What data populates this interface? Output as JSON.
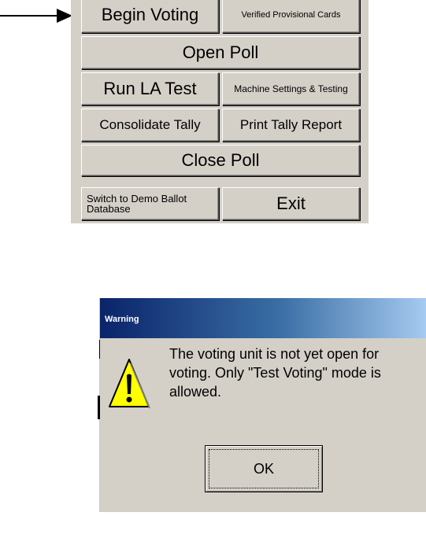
{
  "pointer_arrow": {
    "icon": "pointer-arrow-icon"
  },
  "menu": {
    "begin_voting": "Begin Voting",
    "verified_provisional": "Verified Provisional Cards",
    "open_poll": "Open Poll",
    "run_la_test": "Run LA Test",
    "machine_settings": "Machine Settings & Testing",
    "consolidate_tally": "Consolidate Tally",
    "print_tally_report": "Print Tally Report",
    "close_poll": "Close Poll",
    "switch_demo_line1": "Switch to Demo Ballot",
    "switch_demo_line2": "Database",
    "exit": "Exit"
  },
  "dialog": {
    "title": "Warning",
    "icon": "warning-triangle-icon",
    "message": "The voting unit is not yet open for voting. Only \"Test Voting\" mode is allowed.",
    "ok_label": "OK"
  }
}
